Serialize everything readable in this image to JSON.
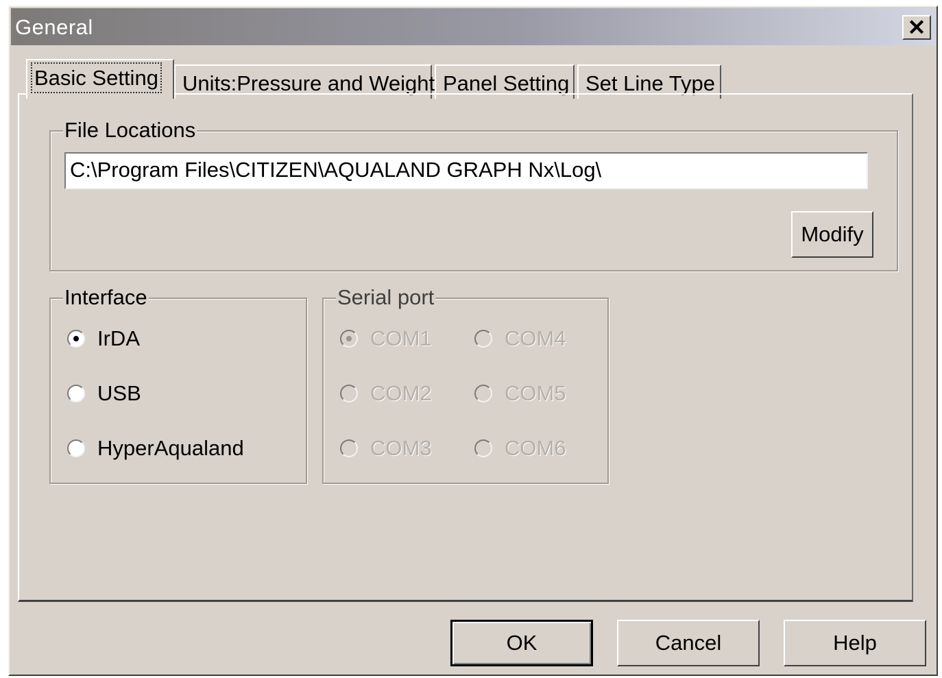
{
  "window": {
    "title": "General",
    "close_symbol": "✕"
  },
  "tabs": [
    {
      "label": "Basic Setting",
      "active": true
    },
    {
      "label": "Units:Pressure and Weight",
      "active": false
    },
    {
      "label": "Panel Setting",
      "active": false
    },
    {
      "label": "Set Line Type",
      "active": false
    }
  ],
  "file_locations": {
    "group_label": "File Locations",
    "path": "C:\\Program Files\\CITIZEN\\AQUALAND GRAPH Nx\\Log\\",
    "modify_label": "Modify"
  },
  "interface": {
    "group_label": "Interface",
    "options": [
      {
        "label": "IrDA",
        "checked": true
      },
      {
        "label": "USB",
        "checked": false
      },
      {
        "label": "HyperAqualand",
        "checked": false
      }
    ]
  },
  "serial_port": {
    "group_label": "Serial port",
    "enabled": false,
    "options": [
      {
        "label": "COM1",
        "checked": true
      },
      {
        "label": "COM2",
        "checked": false
      },
      {
        "label": "COM3",
        "checked": false
      },
      {
        "label": "COM4",
        "checked": false
      },
      {
        "label": "COM5",
        "checked": false
      },
      {
        "label": "COM6",
        "checked": false
      }
    ]
  },
  "buttons": {
    "ok": "OK",
    "cancel": "Cancel",
    "help": "Help"
  },
  "colors": {
    "face": "#d8d2ca",
    "titlebar_start": "#7d7a78",
    "titlebar_end": "#d3d6e2",
    "disabled_text": "#b5b0a9"
  }
}
